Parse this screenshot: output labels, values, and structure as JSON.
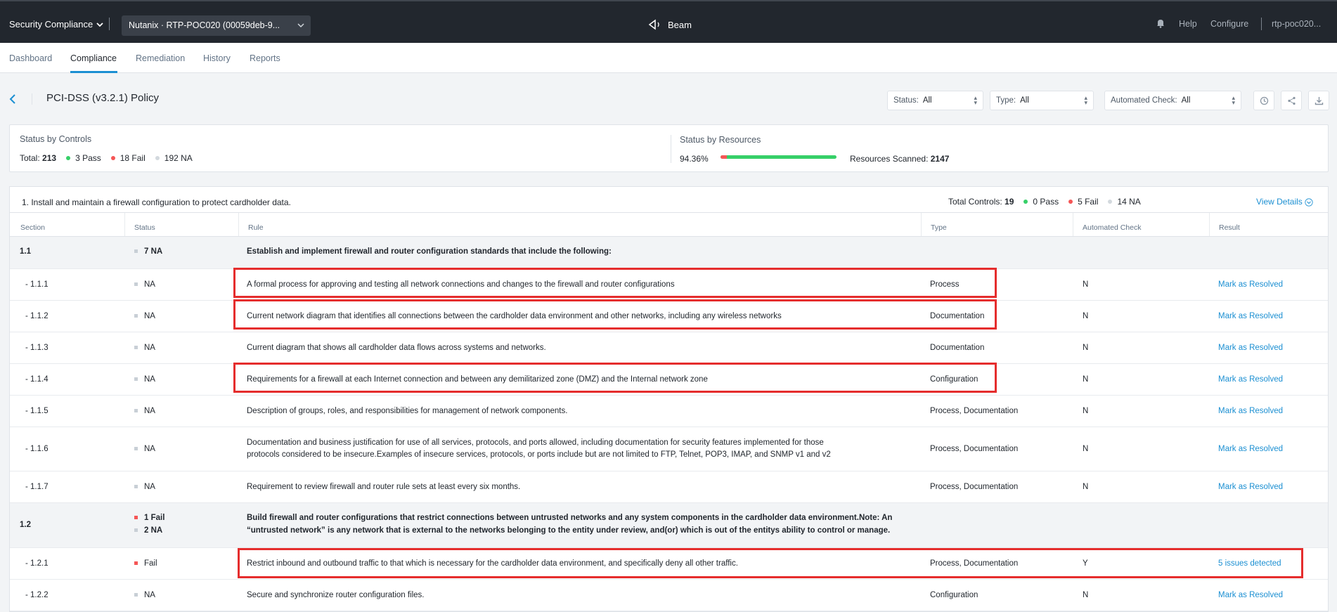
{
  "topbar": {
    "app_name": "Security Compliance",
    "account": "Nutanix · RTP-POC020 (00059deb-9...",
    "product": "Beam",
    "help": "Help",
    "configure": "Configure",
    "user": "rtp-poc020..."
  },
  "nav": {
    "tabs": [
      "Dashboard",
      "Compliance",
      "Remediation",
      "History",
      "Reports"
    ],
    "active": "Compliance"
  },
  "page": {
    "title": "PCI-DSS (v3.2.1) Policy"
  },
  "filters": {
    "status_label": "Status:",
    "status_value": "All",
    "type_label": "Type:",
    "type_value": "All",
    "auto_label": "Automated Check:",
    "auto_value": "All"
  },
  "summary": {
    "controls_title": "Status by Controls",
    "total_label": "Total:",
    "total": "213",
    "pass": "3 Pass",
    "fail": "18 Fail",
    "na": "192 NA",
    "resources_title": "Status by Resources",
    "percent": "94.36%",
    "percent_value": 94.36,
    "scanned_label": "Resources Scanned:",
    "scanned": "2147"
  },
  "requirement": {
    "title": "1. Install and maintain a firewall configuration to protect cardholder data.",
    "total_label": "Total Controls:",
    "total": "19",
    "pass": "0 Pass",
    "fail": "5 Fail",
    "na": "14 NA",
    "view_details": "View Details"
  },
  "table": {
    "headers": [
      "Section",
      "Status",
      "Rule",
      "Type",
      "Automated Check",
      "Result"
    ],
    "rows": [
      {
        "section": "1.1",
        "status": "7 NA",
        "status2": "",
        "rule": "Establish and implement firewall and router configuration standards that include the following:",
        "rule2": "",
        "type": "",
        "auto": "",
        "result": ""
      },
      {
        "section": "- 1.1.1",
        "status": "NA",
        "rule": "A formal process for approving and testing all network connections and changes to the firewall and router configurations",
        "type": "Process",
        "auto": "N",
        "result": "Mark as Resolved"
      },
      {
        "section": "- 1.1.2",
        "status": "NA",
        "rule": "Current network diagram that identifies all connections between the cardholder data environment and other networks, including any wireless networks",
        "type": "Documentation",
        "auto": "N",
        "result": "Mark as Resolved"
      },
      {
        "section": "- 1.1.3",
        "status": "NA",
        "rule": "Current diagram that shows all cardholder data flows across systems and networks.",
        "type": "Documentation",
        "auto": "N",
        "result": "Mark as Resolved"
      },
      {
        "section": "- 1.1.4",
        "status": "NA",
        "rule": "Requirements for a firewall at each Internet connection and between any demilitarized zone (DMZ) and the Internal network zone",
        "type": "Configuration",
        "auto": "N",
        "result": "Mark as Resolved"
      },
      {
        "section": "- 1.1.5",
        "status": "NA",
        "rule": "Description of groups, roles, and responsibilities for management of network components.",
        "type": "Process, Documentation",
        "auto": "N",
        "result": "Mark as Resolved"
      },
      {
        "section": "- 1.1.6",
        "status": "NA",
        "rule": "Documentation and business justification for use of all services, protocols, and ports allowed, including documentation for security features implemented for those",
        "rule2": "protocols considered to be insecure.Examples of insecure services, protocols, or ports include but are not limited to FTP, Telnet, POP3, IMAP, and SNMP v1 and v2",
        "type": "Process, Documentation",
        "auto": "N",
        "result": "Mark as Resolved"
      },
      {
        "section": "- 1.1.7",
        "status": "NA",
        "rule": "Requirement to review firewall and router rule sets at least every six months.",
        "type": "Process, Documentation",
        "auto": "N",
        "result": "Mark as Resolved"
      },
      {
        "section": "1.2",
        "status": "1 Fail",
        "status2": "2 NA",
        "rule": "Build firewall and router configurations that restrict connections between untrusted networks and any system components in the cardholder data environment.Note: An",
        "rule2": "“untrusted network” is any network that is external to the networks belonging to the entity under review, and(or) which is out of the entitys ability to control or manage.",
        "type": "",
        "auto": "",
        "result": ""
      },
      {
        "section": "- 1.2.1",
        "status": "Fail",
        "rule": "Restrict inbound and outbound traffic to that which is necessary for the cardholder data environment, and specifically deny all other traffic.",
        "type": "Process, Documentation",
        "auto": "Y",
        "result": "5 issues detected"
      },
      {
        "section": "- 1.2.2",
        "status": "NA",
        "rule": "Secure and synchronize router configuration files.",
        "type": "Configuration",
        "auto": "N",
        "result": "Mark as Resolved"
      }
    ]
  }
}
